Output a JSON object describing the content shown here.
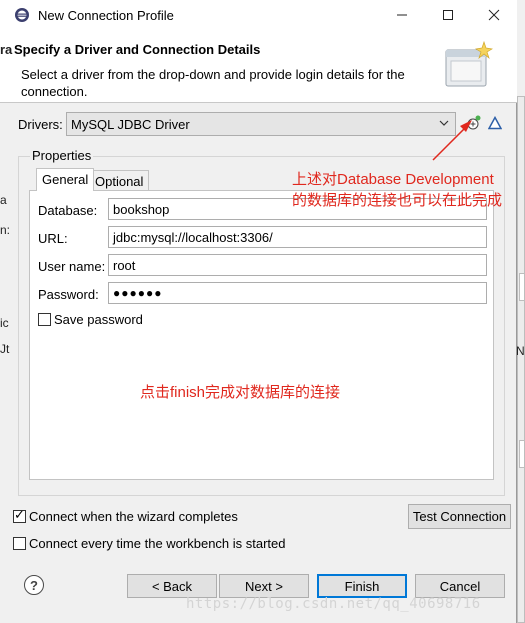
{
  "window": {
    "title": "New Connection Profile"
  },
  "header": {
    "title": "Specify a Driver and Connection Details",
    "description": "Select a driver from the drop-down and provide login details for the connection."
  },
  "drivers": {
    "label": "Drivers:",
    "selected": "MySQL JDBC Driver"
  },
  "properties": {
    "group_label": "Properties",
    "tabs": [
      {
        "label": "General"
      },
      {
        "label": "Optional"
      }
    ],
    "fields": {
      "database": {
        "label": "Database:",
        "value": "bookshop"
      },
      "url": {
        "label": "URL:",
        "value": "jdbc:mysql://localhost:3306/"
      },
      "username": {
        "label": "User name:",
        "value": "root"
      },
      "password": {
        "label": "Password:",
        "value": "●●●●●●"
      }
    },
    "save_password": {
      "label": "Save password",
      "checked": false
    }
  },
  "options": {
    "connect_when_completes": {
      "label": "Connect when the wizard completes",
      "checked": true
    },
    "connect_every_time": {
      "label": "Connect every time the workbench is started",
      "checked": false
    }
  },
  "buttons": {
    "test_connection": "Test Connection",
    "back": "< Back",
    "next": "Next >",
    "finish": "Finish",
    "cancel": "Cancel",
    "help": "?"
  },
  "annotations": {
    "note1_line1": "上述对Database Development",
    "note1_line2": "的数据库的连接也可以在此完成",
    "note2": "点击finish完成对数据库的连接"
  },
  "background_fragments": {
    "a": "ra",
    "b": "a",
    "c": "n:",
    "d": "ic",
    "e": "Jt",
    "f": "Ne"
  },
  "watermark": "https://blog.csdn.net/qq_40698716",
  "colors": {
    "annotation": "#e0281e",
    "accent": "#0078d7"
  }
}
